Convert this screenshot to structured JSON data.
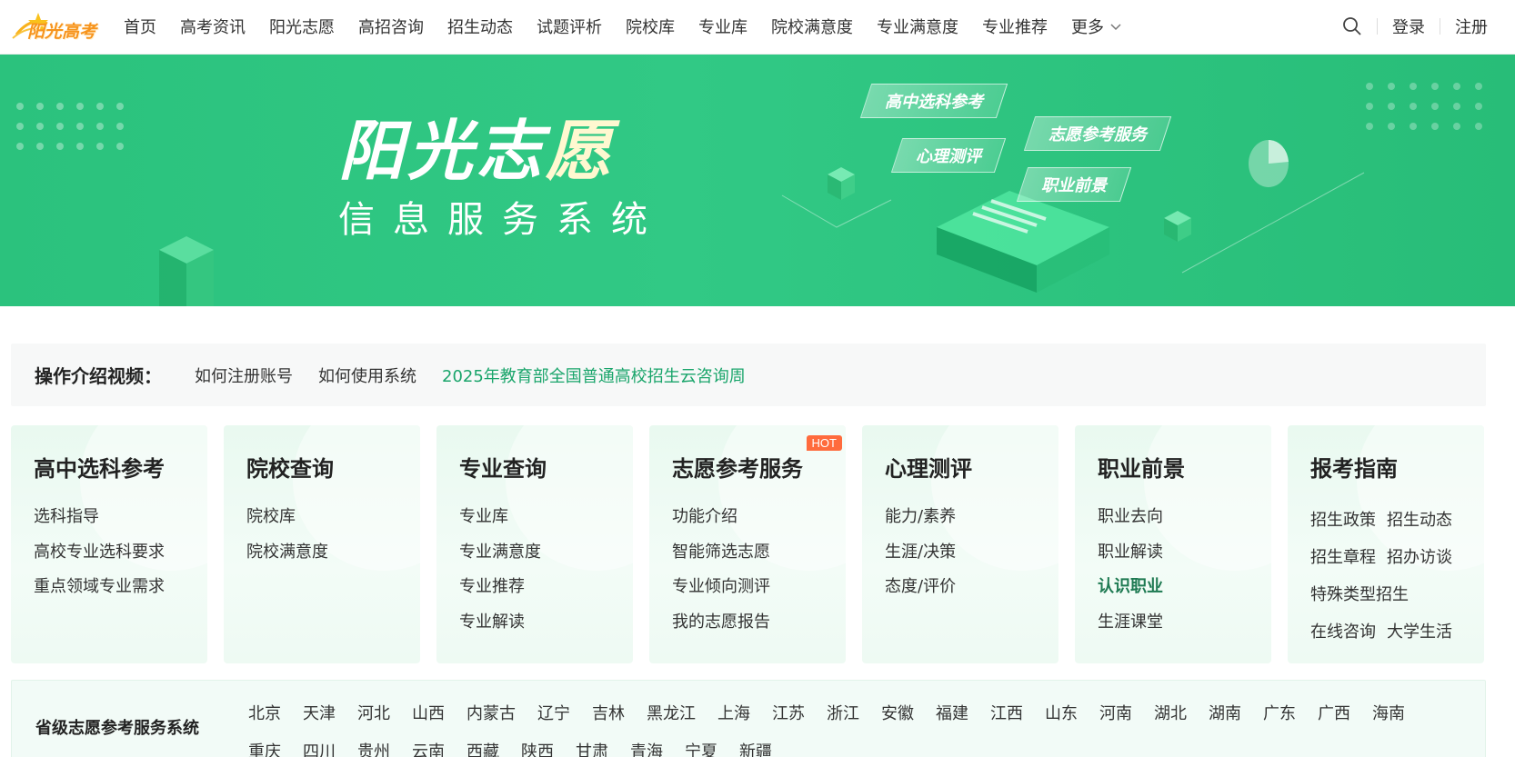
{
  "header": {
    "logo_text": "阳光高考",
    "nav": [
      "首页",
      "高考资讯",
      "阳光志愿",
      "高招咨询",
      "招生动态",
      "试题评析",
      "院校库",
      "专业库",
      "院校满意度",
      "专业满意度",
      "专业推荐"
    ],
    "more_label": "更多",
    "login_label": "登录",
    "register_label": "注册"
  },
  "banner": {
    "title_main": "阳光志",
    "title_tail": "愿",
    "subtitle": "信息服务系统",
    "tags": [
      "高中选科参考",
      "志愿参考服务",
      "心理测评",
      "职业前景"
    ]
  },
  "video_bar": {
    "label": "操作介绍视频：",
    "links": [
      "如何注册账号",
      "如何使用系统"
    ],
    "highlight_link": "2025年教育部全国普通高校招生云咨询周"
  },
  "cards": [
    {
      "title": "高中选科参考",
      "links": [
        "选科指导",
        "高校专业选科要求",
        "重点领域专业需求"
      ]
    },
    {
      "title": "院校查询",
      "links": [
        "院校库",
        "院校满意度"
      ]
    },
    {
      "title": "专业查询",
      "links": [
        "专业库",
        "专业满意度",
        "专业推荐",
        "专业解读"
      ]
    },
    {
      "title": "志愿参考服务",
      "badge": "HOT",
      "links": [
        "功能介绍",
        "智能筛选志愿",
        "专业倾向测评",
        "我的志愿报告"
      ]
    },
    {
      "title": "心理测评",
      "links": [
        "能力/素养",
        "生涯/决策",
        "态度/评价"
      ]
    },
    {
      "title": "职业前景",
      "links": [
        "职业去向",
        "职业解读",
        "认识职业",
        "生涯课堂"
      ]
    },
    {
      "title": "报考指南",
      "links": [
        "招生政策",
        "招生动态",
        "招生章程",
        "招办访谈",
        "特殊类型招生",
        "在线咨询",
        "大学生活"
      ]
    }
  ],
  "provinces": {
    "label": "省级志愿参考服务系统",
    "items": [
      "北京",
      "天津",
      "河北",
      "山西",
      "内蒙古",
      "辽宁",
      "吉林",
      "黑龙江",
      "上海",
      "江苏",
      "浙江",
      "安徽",
      "福建",
      "江西",
      "山东",
      "河南",
      "湖北",
      "湖南",
      "广东",
      "广西",
      "海南",
      "重庆",
      "四川",
      "贵州",
      "云南",
      "西藏",
      "陕西",
      "甘肃",
      "青海",
      "宁夏",
      "新疆"
    ]
  },
  "colors": {
    "brand_orange": "#f7941d",
    "banner_green": "#2bc27d",
    "link_green": "#1aa56b",
    "hot_badge": "#ff6b3d"
  }
}
